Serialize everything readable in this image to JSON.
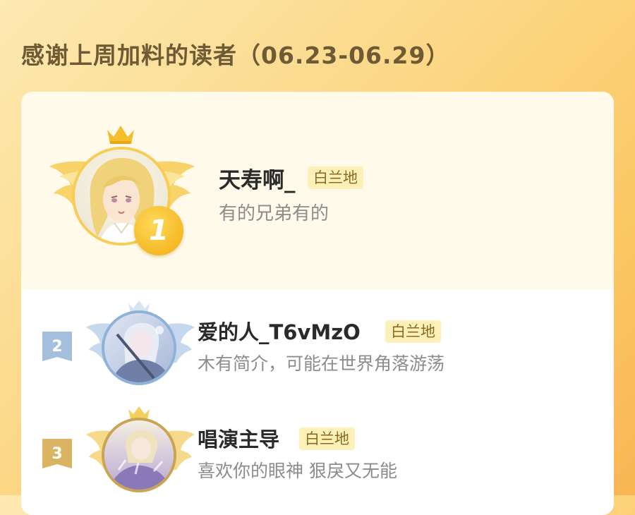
{
  "title": "感谢上周加料的读者（06.23-06.29）",
  "badge_label": "白兰地",
  "readers": [
    {
      "rank": "1",
      "name": "天寿啊_",
      "badge": "白兰地",
      "bio": "有的兄弟有的"
    },
    {
      "rank": "2",
      "name": "爱的人_T6vMzO",
      "badge": "白兰地",
      "bio": "木有简介，可能在世界角落游荡"
    },
    {
      "rank": "3",
      "name": "唱演主导",
      "badge": "白兰地",
      "bio": "喜欢你的眼神 狠戾又无能"
    }
  ],
  "colors": {
    "gold": "#f3b92a",
    "silver": "#9fbad6",
    "bronze": "#d9b463"
  }
}
